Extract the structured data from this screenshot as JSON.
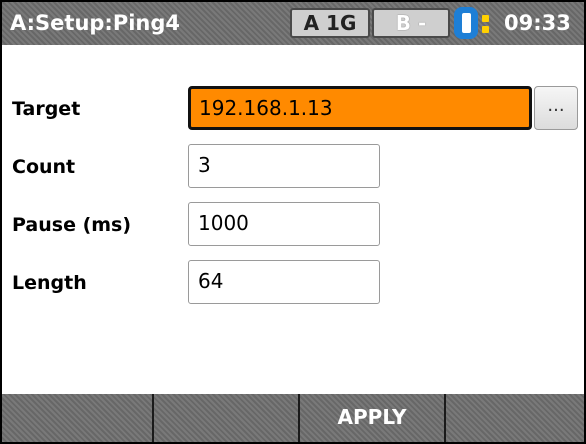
{
  "title_bar": {
    "app_title": "A:Setup:Ping4",
    "port_a": "A 1G",
    "port_b": "B -",
    "battery_icon": "battery-icon",
    "time": "09:33"
  },
  "form": {
    "target_label": "Target",
    "target_value": "192.168.1.13",
    "browse_label": "...",
    "count_label": "Count",
    "count_value": "3",
    "pause_label": "Pause (ms)",
    "pause_value": "1000",
    "length_label": "Length",
    "length_value": "64"
  },
  "softkeys": [
    "",
    "",
    "APPLY",
    ""
  ],
  "colors": {
    "active_field": "#ff8a00",
    "title_bar": "#6f6f6f",
    "battery": "#1e7fd6"
  }
}
